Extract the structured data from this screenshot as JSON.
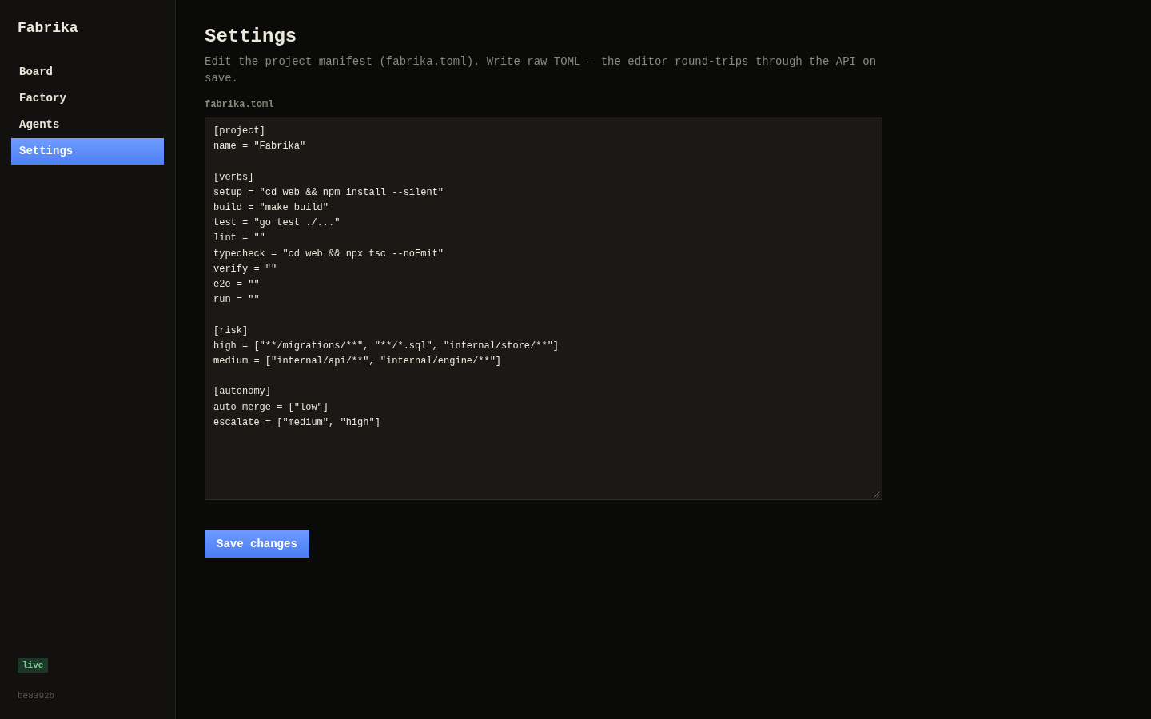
{
  "sidebar": {
    "brand": "Fabrika",
    "nav": [
      {
        "label": "Board",
        "selected": false
      },
      {
        "label": "Factory",
        "selected": false
      },
      {
        "label": "Agents",
        "selected": false
      },
      {
        "label": "Settings",
        "selected": true
      }
    ],
    "status_badge": "live",
    "version": "be8392b"
  },
  "page": {
    "title": "Settings",
    "description": "Edit the project manifest (fabrika.toml). Write raw TOML — the editor round-trips through the API on save.",
    "editor": {
      "label": "fabrika.toml",
      "value": "[project]\nname = \"Fabrika\"\n\n[verbs]\nsetup = \"cd web && npm install --silent\"\nbuild = \"make build\"\ntest = \"go test ./...\"\nlint = \"\"\ntypecheck = \"cd web && npx tsc --noEmit\"\nverify = \"\"\ne2e = \"\"\nrun = \"\"\n\n[risk]\nhigh = [\"**/migrations/**\", \"**/*.sql\", \"internal/store/**\"]\nmedium = [\"internal/api/**\", \"internal/engine/**\"]\n\n[autonomy]\nauto_merge = [\"low\"]\nescalate = [\"medium\", \"high\"]"
    },
    "save_button": "Save changes"
  }
}
